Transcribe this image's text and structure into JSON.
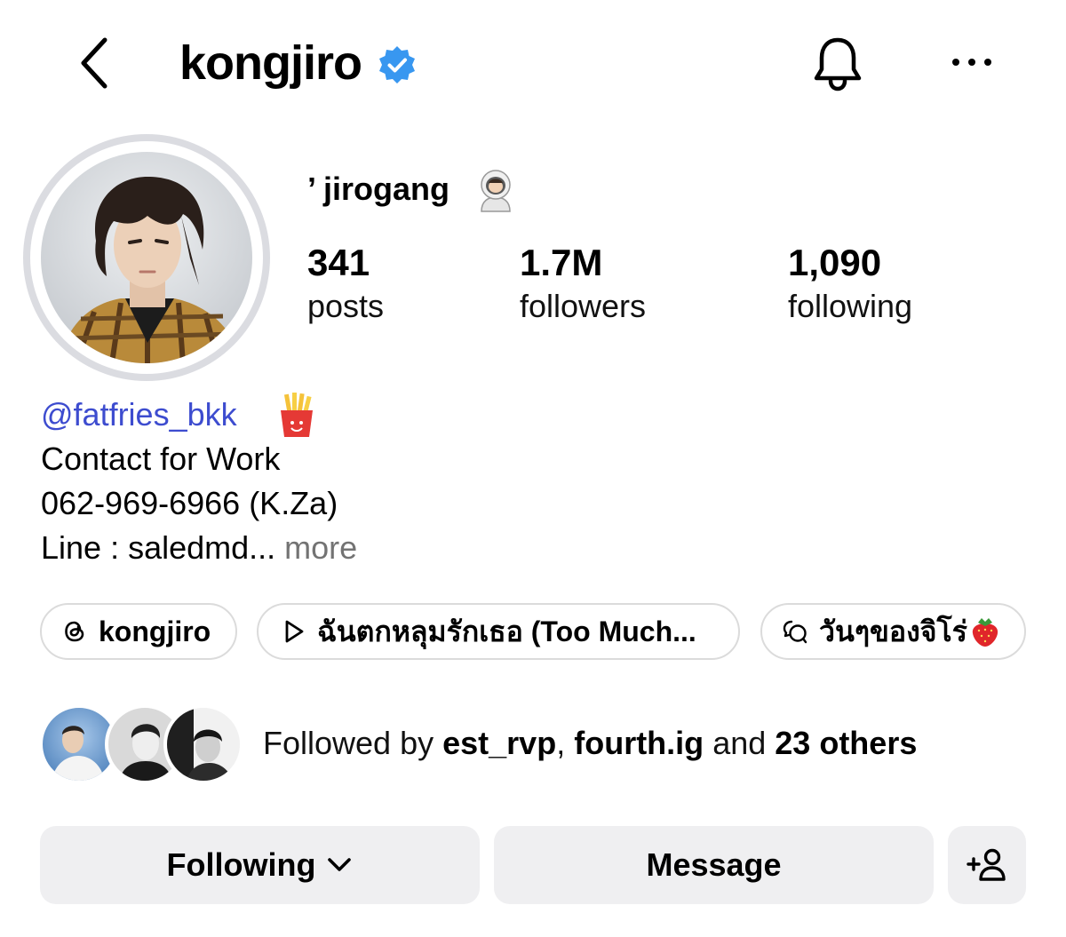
{
  "header": {
    "username": "kongjiro",
    "icons": {
      "back": "chevron-left-icon",
      "verified": "verified-badge-icon",
      "notifications": "bell-icon",
      "more": "more-horizontal-icon"
    }
  },
  "profile": {
    "display_name": "’ jirogang",
    "stats": [
      {
        "value": "341",
        "label": "posts"
      },
      {
        "value": "1.7M",
        "label": "followers"
      },
      {
        "value": "1,090",
        "label": "following"
      }
    ]
  },
  "bio": {
    "mention": "@fatfries_bkk",
    "line1": "Contact for Work",
    "line2": "062-969-6966 (K.Za)",
    "line3": "Line : saledmd...",
    "more": "more"
  },
  "chips": [
    {
      "icon": "threads-icon",
      "label": "kongjiro"
    },
    {
      "icon": "play-icon",
      "label": "ฉันตกหลุมรักเธอ (Too Much..."
    },
    {
      "icon": "channel-chat-icon",
      "label": "วันๆของจิโร่"
    }
  ],
  "followed_by": {
    "prefix": "Followed by",
    "user1": "est_rvp",
    "separator": ",",
    "user2": "fourth.ig",
    "conjunction": "and",
    "others": "23 others"
  },
  "actions": {
    "following": "Following",
    "message": "Message",
    "add_user_icon": "add-person-icon"
  },
  "colors": {
    "verified": "#3897f0",
    "mention": "#3d4ccf",
    "muted": "#737373",
    "button_bg": "#efeff1",
    "chip_border": "#dbdbdb"
  }
}
